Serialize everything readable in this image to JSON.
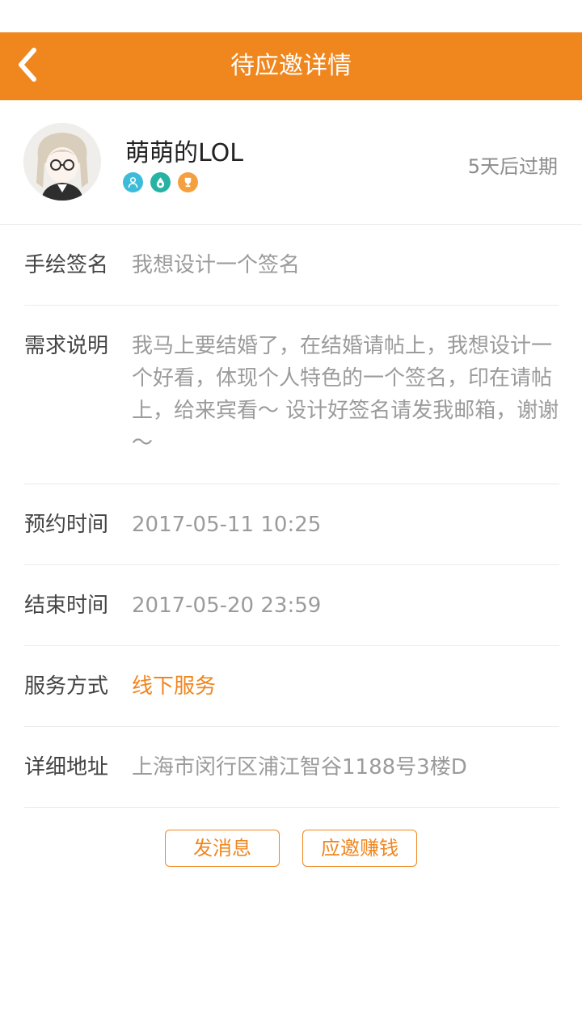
{
  "header": {
    "title": "待应邀详情",
    "back_icon": "chevron-left-icon"
  },
  "profile": {
    "username": "萌萌的LOL",
    "expire_text": "5天后过期",
    "badges": [
      {
        "icon": "user-icon",
        "color": "#3cbcd8"
      },
      {
        "icon": "drop-icon",
        "color": "#26b3a4"
      },
      {
        "icon": "trophy-icon",
        "color": "#f5a040"
      }
    ]
  },
  "details": {
    "title_label": "手绘签名",
    "title_value": "我想设计一个签名",
    "desc_label": "需求说明",
    "desc_value": "我马上要结婚了，在结婚请帖上，我想设计一个好看，体现个人特色的一个签名，印在请帖上，给来宾看～ 设计好签名请发我邮箱，谢谢～",
    "appoint_label": "预约时间",
    "appoint_value": "2017-05-11 10:25",
    "end_label": "结束时间",
    "end_value": "2017-05-20 23:59",
    "service_label": "服务方式",
    "service_value": "线下服务",
    "address_label": "详细地址",
    "address_value": "上海市闵行区浦江智谷1188号3楼D"
  },
  "actions": {
    "message_label": "发消息",
    "accept_label": "应邀赚钱"
  },
  "colors": {
    "accent": "#f0861e",
    "label": "#444444",
    "value": "#9b9b9b"
  }
}
